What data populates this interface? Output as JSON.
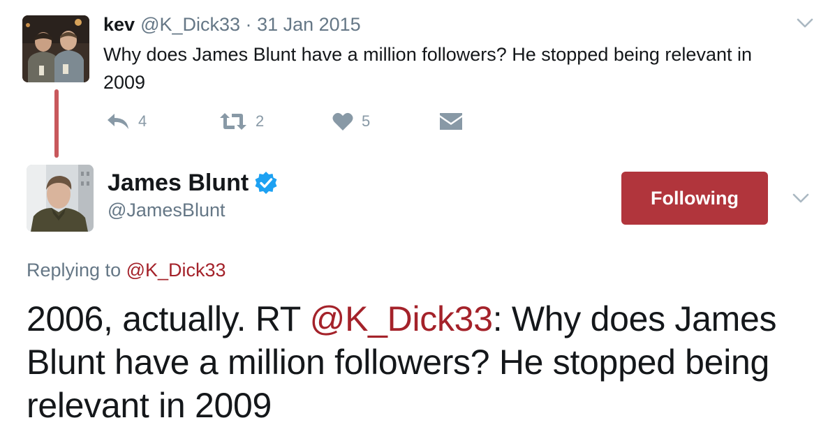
{
  "original_tweet": {
    "author_name": "kev",
    "author_handle": "@K_Dick33",
    "separator": "·",
    "date": "31 Jan 2015",
    "text": "Why does James Blunt have a million followers? He stopped being relevant in 2009",
    "actions": {
      "reply_count": "4",
      "retweet_count": "2",
      "like_count": "5"
    },
    "avatar_icon": "profile-photo-two-men"
  },
  "reply_tweet": {
    "author_name": "James Blunt",
    "author_handle": "@JamesBlunt",
    "verified_icon": "verified-badge-icon",
    "follow_button_label": "Following",
    "replying_prefix": "Replying to",
    "replying_handle": "@K_Dick33",
    "text_before_mention": "2006, actually. RT ",
    "mention": "@K_Dick33",
    "text_after_mention": ": Why does James Blunt have a million followers? He stopped being relevant in 2009",
    "avatar_icon": "profile-photo-man"
  },
  "colors": {
    "accent": "#b1353c",
    "link": "#a4222a",
    "thread_line": "#c8585c",
    "verified_blue": "#1da1f2",
    "muted_text": "#657786",
    "icon_gray": "#8899a6"
  }
}
